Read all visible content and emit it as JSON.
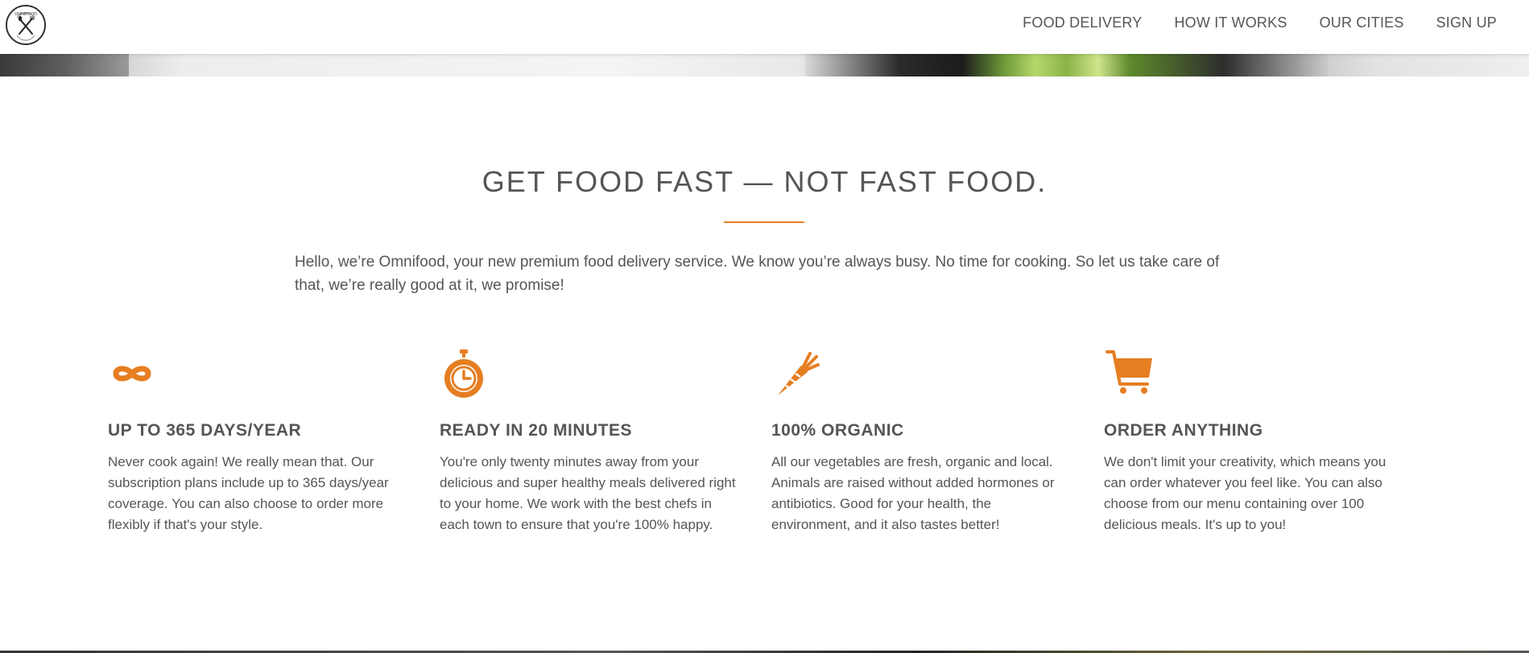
{
  "nav": {
    "logo_text": "OMNIFOOD",
    "links": [
      "FOOD DELIVERY",
      "HOW IT WORKS",
      "OUR CITIES",
      "SIGN UP"
    ]
  },
  "section": {
    "title": "GET FOOD FAST — NOT FAST FOOD.",
    "intro": "Hello, we’re Omnifood, your new premium food delivery service. We know you’re always busy. No time for cooking. So let us take care of that, we’re really good at it, we promise!"
  },
  "features": [
    {
      "icon": "infinity-icon",
      "title": "UP TO 365 DAYS/YEAR",
      "text": "Never cook again! We really mean that. Our subscription plans include up to 365 days/year coverage. You can also choose to order more flexibly if that's your style."
    },
    {
      "icon": "stopwatch-icon",
      "title": "READY IN 20 MINUTES",
      "text": "You're only twenty minutes away from your delicious and super healthy meals delivered right to your home. We work with the best chefs in each town to ensure that you're 100% happy."
    },
    {
      "icon": "carrot-icon",
      "title": "100% ORGANIC",
      "text": "All our vegetables are fresh, organic and local. Animals are raised without added hormones or antibiotics. Good for your health, the environment, and it also tastes better!"
    },
    {
      "icon": "cart-icon",
      "title": "ORDER ANYTHING",
      "text": "We don't limit your creativity, which means you can order whatever you feel like. You can also choose from our menu containing over 100 delicious meals. It's up to you!"
    }
  ],
  "colors": {
    "accent": "#e67e22",
    "text": "#555555"
  }
}
